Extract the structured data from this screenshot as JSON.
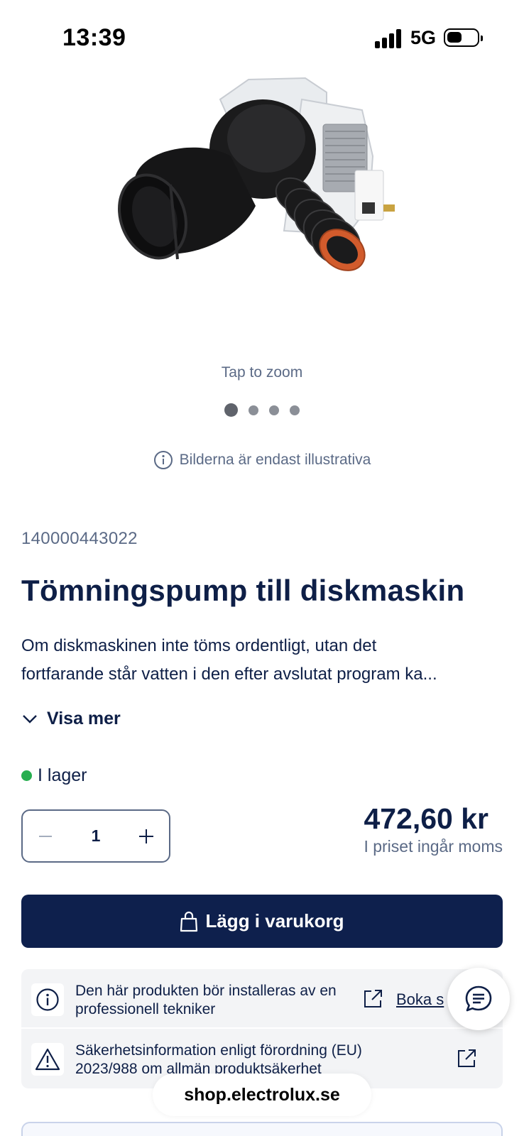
{
  "status_bar": {
    "time": "13:39",
    "network": "5G"
  },
  "gallery": {
    "image_icon": "drain-pump-image",
    "zoom_hint": "Tap to zoom",
    "slide_count": 4,
    "active_slide": 1,
    "illustrative_note": "Bilderna är endast illustrativa"
  },
  "product": {
    "sku": "140000443022",
    "title": "Tömningspump till diskmaskin",
    "description_line1": "Om diskmaskinen inte töms ordentligt, utan det",
    "description_line2": "fortfarande står vatten i den efter avslutat program ka...",
    "show_more_label": "Visa mer",
    "stock_label": "I lager",
    "quantity": "1",
    "price": "472,60 kr",
    "vat_note": "I priset ingår moms"
  },
  "cart": {
    "add_label": "Lägg i varukorg"
  },
  "info": {
    "install_text": "Den här produkten bör installeras av en professionell tekniker",
    "book_label": "Boka s",
    "safety_text": "Säkerhetsinformation enligt förordning (EU) 2023/988 om allmän produktsäkerhet"
  },
  "browser": {
    "url": "shop.electrolux.se"
  },
  "colors": {
    "primary": "#0e204d",
    "text": "#0e1f47",
    "muted": "#5b6a86",
    "in_stock": "#27ae4f",
    "info_bg": "#f3f4f6"
  }
}
